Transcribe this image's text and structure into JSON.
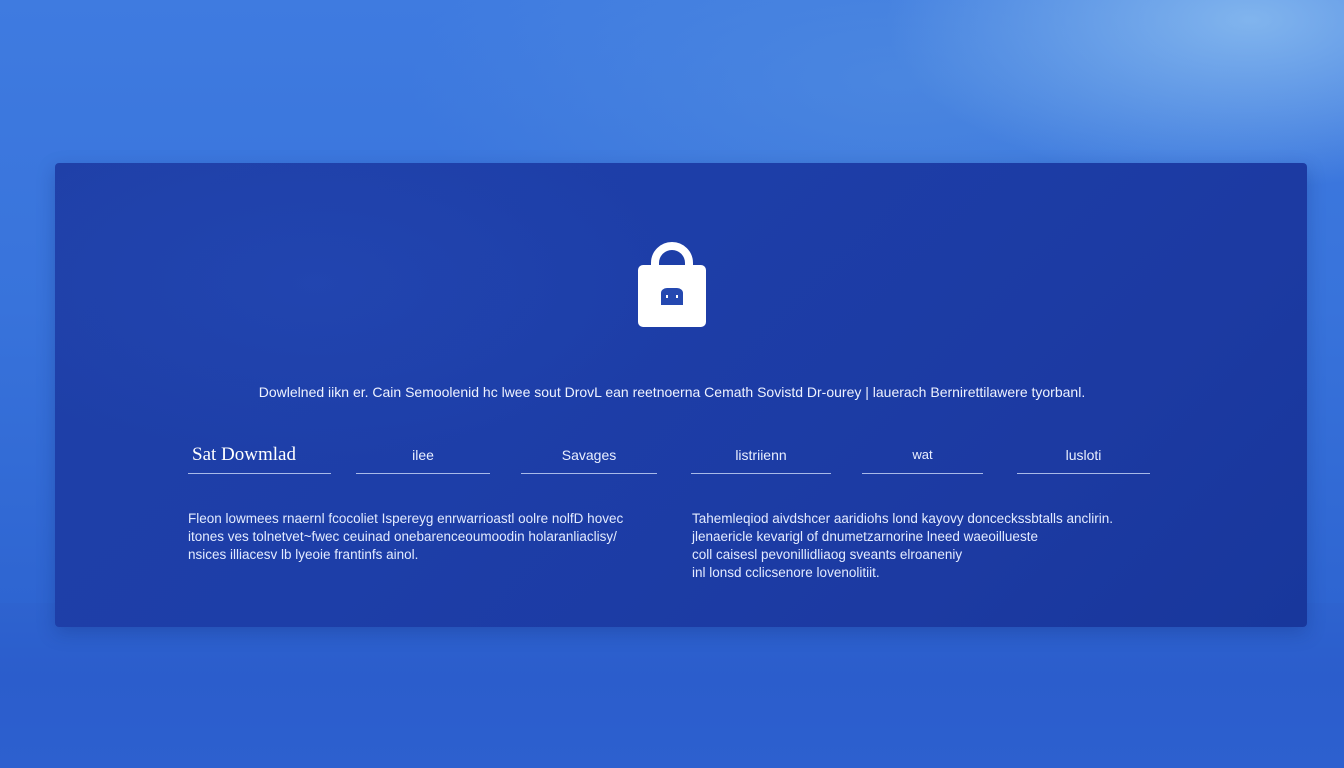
{
  "panel": {
    "description": "Dowlelned iikn er. Cain Semoolenid  hc lwee sout DrovL ean reetnoerna Cemath Sovistd Dr-ourey  |  lauerach Bernirettilawere tyorbanl.",
    "tabs": [
      {
        "label": "Sat  Dowmlad"
      },
      {
        "label": "ilee"
      },
      {
        "label": "Savages"
      },
      {
        "label": "listriienn"
      },
      {
        "label": "wat"
      },
      {
        "label": "lusloti"
      }
    ],
    "left_paragraph": [
      "Fleon lowmees rnaernl fcocoliet Ispereyg enrwarrioastl oolre nolfD hovec",
      "itones  ves  tolnetvet~fwec ceuinad onebarenceoumoodin holaranliaclisy/",
      " nsices illiacesv lb lyeoie frantinfs ainol."
    ],
    "right_paragraph": [
      "Tahemleqiod aivdshcer aaridiohs lond kayovy donceckssbtalls anclirin.",
      "jlenaericle kevarigl of dnumetzarnorine lneed  waeoillueste",
      " coll caisesl pevonillidliaog sveants elroaneniy",
      " inl lonsd cclicsenore lovenolitiit."
    ]
  },
  "icons": {
    "lock": "lock-icon"
  },
  "colors": {
    "background": "#3873db",
    "panel": "#1d3ea8",
    "text": "#ffffff"
  }
}
